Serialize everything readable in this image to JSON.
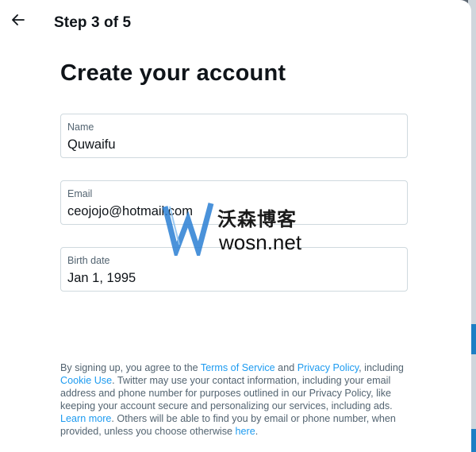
{
  "header": {
    "step_label": "Step 3 of 5",
    "back_icon": "arrow-left-icon"
  },
  "page": {
    "title": "Create your account"
  },
  "fields": {
    "name": {
      "label": "Name",
      "value": "Quwaifu"
    },
    "email": {
      "label": "Email",
      "value": "ceojojo@hotmail.com"
    },
    "birth": {
      "label": "Birth date",
      "value": "Jan 1, 1995"
    }
  },
  "legal": {
    "t1": "By signing up, you agree to the ",
    "terms_link": "Terms of Service",
    "t2": " and ",
    "privacy_link": "Privacy Policy",
    "t3": ", including ",
    "cookie_link": "Cookie Use",
    "t4": ". Twitter may use your contact information, including your email address and phone number for purposes outlined in our Privacy Policy, like keeping your account secure and personalizing our services, including ads. ",
    "learn_link": "Learn more",
    "t5": ". Others will be able to find you by email or phone number, when provided, unless you choose otherwise ",
    "here_link": "here",
    "t6": "."
  },
  "watermark": {
    "cn": "沃森博客",
    "en": "wosn.net"
  },
  "colors": {
    "link": "#1d9bf0",
    "muted_text": "#536471",
    "border": "#cfd9de"
  }
}
